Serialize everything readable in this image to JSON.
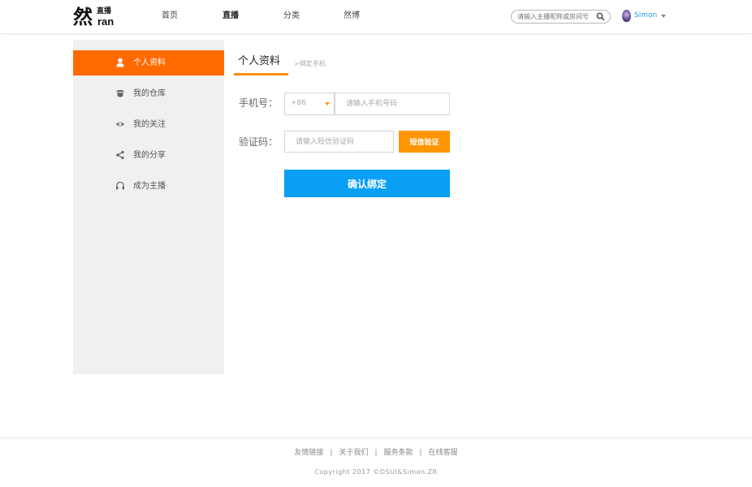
{
  "brand": {
    "logo_main": "然",
    "logo_sub": "直播",
    "logo_en": "ran"
  },
  "nav": [
    {
      "label": "首页"
    },
    {
      "label": "直播"
    },
    {
      "label": "分类"
    },
    {
      "label": "然博"
    }
  ],
  "search": {
    "placeholder": "请输入主播昵称或房间号",
    "icon": "search-icon"
  },
  "user": {
    "name": "Simon"
  },
  "sidebar": {
    "items": [
      {
        "label": "个人资料",
        "icon": "user-icon",
        "active": true
      },
      {
        "label": "我的仓库",
        "icon": "warehouse-icon"
      },
      {
        "label": "我的关注",
        "icon": "eye-icon"
      },
      {
        "label": "我的分享",
        "icon": "share-icon"
      },
      {
        "label": "成为主播",
        "icon": "headphones-icon"
      }
    ]
  },
  "page": {
    "title": "个人资料",
    "breadcrumb": ">绑定手机"
  },
  "form": {
    "phone_label": "手机号：",
    "country_code": "+86",
    "phone_placeholder": "请输入手机号码",
    "code_label": "验证码：",
    "code_placeholder": "请输入短信验证码",
    "sms_button": "短信验证",
    "confirm_button": "确认绑定"
  },
  "footer": {
    "links": [
      "友情链接",
      "关于我们",
      "服务条款",
      "在线客服"
    ],
    "separator": "|",
    "copyright": "Copyright 2017 ©DSUI&Simon.ZR"
  },
  "colors": {
    "accent_orange": "#ff6a00",
    "sms_orange": "#ff9600",
    "primary_blue": "#0a9ff5",
    "link_blue": "#1e9cf0"
  }
}
